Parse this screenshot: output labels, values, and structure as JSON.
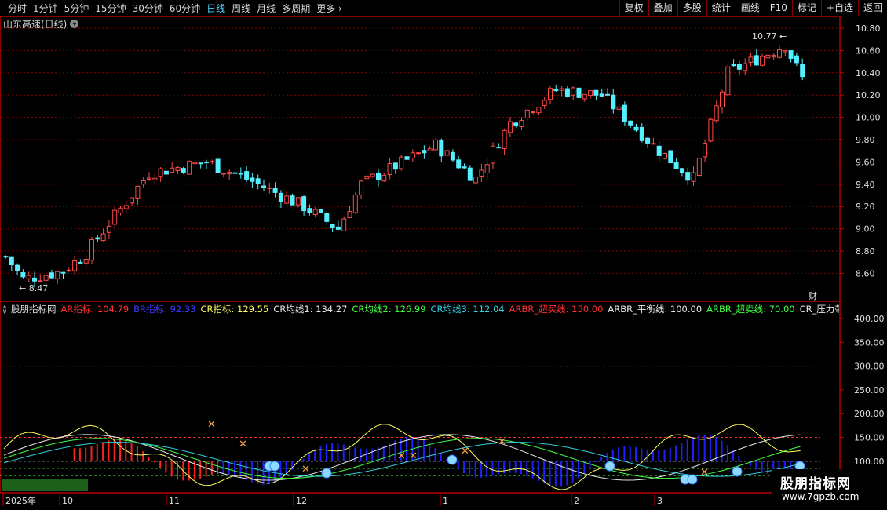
{
  "toolbar": {
    "timeframes": [
      "分时",
      "1分钟",
      "5分钟",
      "15分钟",
      "30分钟",
      "60分钟",
      "日线",
      "周线",
      "月线",
      "多周期",
      "更多"
    ],
    "active": "日线",
    "buttons": [
      "复权",
      "叠加",
      "多股",
      "统计",
      "画线",
      "F10",
      "标记",
      "+自选",
      "返回"
    ]
  },
  "chart_title": "山东高速(日线)",
  "price_axis": [
    "10.80",
    "10.60",
    "10.40",
    "10.20",
    "10.00",
    "9.80",
    "9.60",
    "9.40",
    "9.20",
    "9.00",
    "8.80",
    "8.60"
  ],
  "price_markers": {
    "high": "10.77",
    "low": "8.47"
  },
  "cai_badge": "财",
  "indicator": {
    "name": "股朋指标网",
    "items": [
      {
        "text": "AR指标: 104.79",
        "color": "#ff3030"
      },
      {
        "text": "BR指标: 92.33",
        "color": "#3a3aff"
      },
      {
        "text": "CR指标: 129.55",
        "color": "#ffff60"
      },
      {
        "text": "CR均线1: 134.27",
        "color": "#e8e8e8"
      },
      {
        "text": "CR均线2: 126.99",
        "color": "#40ff40"
      },
      {
        "text": "CR均线3: 112.04",
        "color": "#30d0e0"
      },
      {
        "text": "ARBR_超买线: 150.00",
        "color": "#ff3030"
      },
      {
        "text": "ARBR_平衡线: 100.00",
        "color": "#e8e8e8"
      },
      {
        "text": "ARBR_超卖线: 70.00",
        "color": "#40ff40"
      },
      {
        "text": "CR_压力带/",
        "color": "#e8e8e8"
      }
    ]
  },
  "ind_axis": [
    "400.00",
    "350.00",
    "300.00",
    "250.00",
    "200.00",
    "150.00",
    "100.00"
  ],
  "date_axis": [
    "2025年",
    "10",
    "11",
    "12",
    "1",
    "2",
    "3"
  ],
  "watermark": {
    "title": "股朋指标网",
    "url": "www.7gpzb.com"
  },
  "colors": {
    "up": "#ff4a4a",
    "down": "#54f0ff",
    "grid": "#8a0000"
  }
}
